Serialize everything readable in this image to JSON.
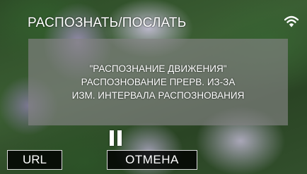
{
  "header": {
    "title": "РАСПОЗНАТЬ/ПОСЛАТЬ",
    "wifi_icon": "wifi-icon"
  },
  "dialog": {
    "lines": [
      "\"РАСПОЗНАНИЕ ДВИЖЕНИЯ\"",
      "РАСПОЗНОВАНИЕ ПРЕРВ. ИЗ-ЗА",
      "ИЗМ. ИНТЕРВАЛА РАСПОЗНОВАНИЯ"
    ]
  },
  "status": {
    "pause_icon": "pause-icon"
  },
  "buttons": {
    "url_label": "URL",
    "cancel_label": "ОТМЕНА"
  }
}
